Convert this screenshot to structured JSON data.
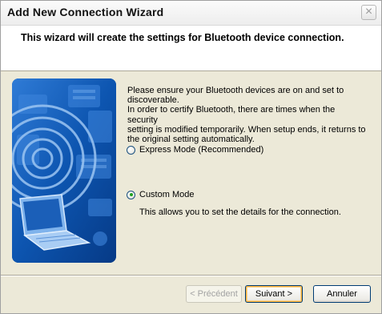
{
  "window": {
    "title": "Add New Connection Wizard",
    "close_glyph": "×"
  },
  "header": {
    "text": "This wizard will create the settings for Bluetooth device connection."
  },
  "description": {
    "line1": "Please ensure your Bluetooth devices are on and set to",
    "line2": "discoverable.",
    "line3": "In order to certify Bluetooth, there are times when the security",
    "line4": "setting is modified temporarily. When setup ends, it returns to",
    "line5": "the original setting automatically."
  },
  "options": {
    "express": {
      "label": "Express Mode (Recommended)",
      "selected": false
    },
    "custom": {
      "label": "Custom Mode",
      "selected": true,
      "description": "This allows you to set the details for the connection."
    }
  },
  "buttons": {
    "back": "< Précédent",
    "next": "Suivant >",
    "cancel": "Annuler"
  },
  "colors": {
    "illustration_blue": "#0b4ea2",
    "radio_dot": "#21a121"
  }
}
